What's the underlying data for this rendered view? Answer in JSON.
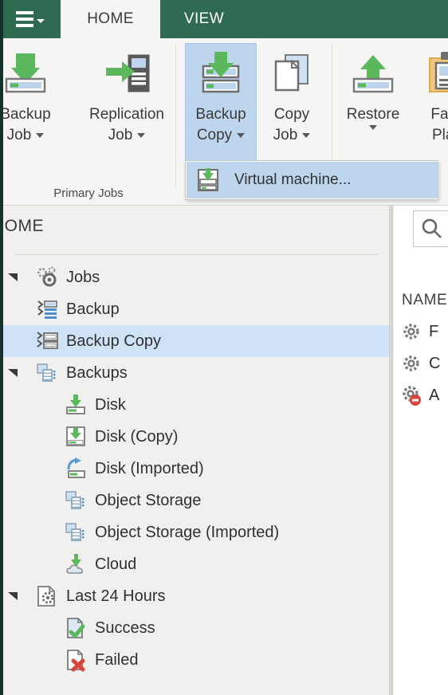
{
  "window": {
    "app_menu_icon": "hamburger-menu-icon",
    "accent_green": "#2f6b50",
    "selection_blue": "#bdd6ee",
    "tree_selection_blue": "#cfe3f7"
  },
  "ribbon_tabs": [
    {
      "id": "home",
      "label": "HOME",
      "active": true
    },
    {
      "id": "view",
      "label": "VIEW",
      "active": false
    }
  ],
  "ribbon": {
    "groups": [
      {
        "id": "primary-jobs",
        "label": "Primary Jobs",
        "buttons": [
          {
            "id": "backup-job",
            "line1": "Backup",
            "line2": "Job",
            "has_caret": true,
            "selected": false,
            "icon": "backup-job-icon"
          },
          {
            "id": "replication-job",
            "line1": "Replication",
            "line2": "Job",
            "has_caret": true,
            "selected": false,
            "icon": "replication-job-icon"
          }
        ]
      },
      {
        "id": "auxiliary-jobs",
        "label": "",
        "buttons": [
          {
            "id": "backup-copy",
            "line1": "Backup",
            "line2": "Copy",
            "has_caret": true,
            "selected": true,
            "icon": "backup-copy-icon"
          },
          {
            "id": "copy-job",
            "line1": "Copy",
            "line2": "Job",
            "has_caret": true,
            "selected": false,
            "icon": "copy-job-icon"
          }
        ]
      },
      {
        "id": "restore-group",
        "label": "",
        "buttons": [
          {
            "id": "restore",
            "line1": "Restore",
            "line2": "",
            "has_caret": true,
            "selected": false,
            "icon": "restore-icon"
          },
          {
            "id": "failover-plan",
            "line1": "Failo",
            "line2": "Plan",
            "has_caret": false,
            "selected": false,
            "icon": "failover-plan-icon"
          }
        ]
      }
    ]
  },
  "dropdown": {
    "open": true,
    "items": [
      {
        "id": "virtual-machine",
        "label": "Virtual machine...",
        "icon": "backup-copy-vm-icon",
        "highlighted": true
      }
    ]
  },
  "nav": {
    "header": "HOME",
    "tree": [
      {
        "id": "jobs",
        "label": "Jobs",
        "level": 0,
        "icon": "jobs-gears-icon",
        "expander": "collapse",
        "selected": false
      },
      {
        "id": "backup",
        "label": "Backup",
        "level": 1,
        "icon": "backup-job-tree-icon",
        "expander": "none",
        "selected": false
      },
      {
        "id": "backup-copy",
        "label": "Backup Copy",
        "level": 1,
        "icon": "backup-copy-tree-icon",
        "expander": "none",
        "selected": true
      },
      {
        "id": "backups",
        "label": "Backups",
        "level": 0,
        "icon": "backups-icon",
        "expander": "collapse",
        "selected": false
      },
      {
        "id": "disk",
        "label": "Disk",
        "level": 1,
        "icon": "disk-icon",
        "expander": "none",
        "selected": false
      },
      {
        "id": "disk-copy",
        "label": "Disk (Copy)",
        "level": 1,
        "icon": "disk-copy-icon",
        "expander": "none",
        "selected": false
      },
      {
        "id": "disk-imported",
        "label": "Disk (Imported)",
        "level": 1,
        "icon": "disk-imported-icon",
        "expander": "none",
        "selected": false
      },
      {
        "id": "object-storage",
        "label": "Object Storage",
        "level": 1,
        "icon": "object-storage-icon",
        "expander": "none",
        "selected": false
      },
      {
        "id": "object-storage-imported",
        "label": "Object Storage (Imported)",
        "level": 1,
        "icon": "object-storage-icon",
        "expander": "none",
        "selected": false
      },
      {
        "id": "cloud",
        "label": "Cloud",
        "level": 1,
        "icon": "cloud-icon",
        "expander": "none",
        "selected": false
      },
      {
        "id": "last-24-hours",
        "label": "Last 24 Hours",
        "level": 0,
        "icon": "last-24-hours-icon",
        "expander": "collapse",
        "selected": false
      },
      {
        "id": "success",
        "label": "Success",
        "level": 1,
        "icon": "success-icon",
        "expander": "none",
        "selected": false
      },
      {
        "id": "failed",
        "label": "Failed",
        "level": 1,
        "icon": "failed-icon",
        "expander": "none",
        "selected": false
      }
    ]
  },
  "right_pane": {
    "search": {
      "icon": "search-icon",
      "value": "",
      "placeholder": ""
    },
    "columns": [
      "NAME"
    ],
    "rows": [
      {
        "id": "row-1",
        "label": "F",
        "icon": "job-gear-icon",
        "state": "normal"
      },
      {
        "id": "row-2",
        "label": "C",
        "icon": "job-gear-icon",
        "state": "normal"
      },
      {
        "id": "row-3",
        "label": "A",
        "icon": "job-gear-disabled-icon",
        "state": "disabled"
      }
    ]
  }
}
